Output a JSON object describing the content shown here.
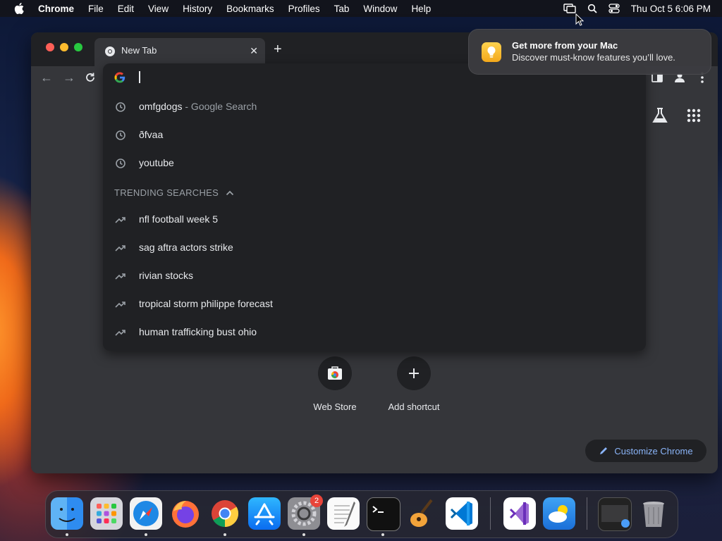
{
  "menubar": {
    "app": "Chrome",
    "items": [
      "File",
      "Edit",
      "View",
      "History",
      "Bookmarks",
      "Profiles",
      "Tab",
      "Window",
      "Help"
    ],
    "clock": "Thu Oct 5  6:06 PM"
  },
  "browser": {
    "tab_title": "New Tab",
    "omnibox_value": ""
  },
  "omnibox": {
    "history": [
      {
        "text": "omfgdogs",
        "sub": " - Google Search"
      },
      {
        "text": "ðfvaa",
        "sub": ""
      },
      {
        "text": "youtube",
        "sub": ""
      }
    ],
    "trending_header": "TRENDING SEARCHES",
    "trending": [
      "nfl football week 5",
      "sag aftra actors strike",
      "rivian stocks",
      "tropical storm philippe forecast",
      "human trafficking bust ohio"
    ]
  },
  "shortcuts": [
    {
      "label": "Web Store"
    },
    {
      "label": "Add shortcut"
    }
  ],
  "customize_label": "Customize Chrome",
  "notification": {
    "title": "Get more from your Mac",
    "body": "Discover must-know features you’ll love."
  },
  "dock": {
    "apps": [
      "Finder",
      "Launchpad",
      "Safari",
      "Firefox",
      "Google Chrome",
      "App Store",
      "System Settings",
      "TextEdit",
      "Terminal",
      "GarageBand",
      "Visual Studio Code",
      "Visual Studio",
      "Weather",
      "Screenshot",
      "Trash"
    ],
    "settings_badge": "2"
  },
  "colors": {
    "window_bg": "#35363a",
    "dropdown_bg": "#202124",
    "link_blue": "#8ab4f8"
  }
}
